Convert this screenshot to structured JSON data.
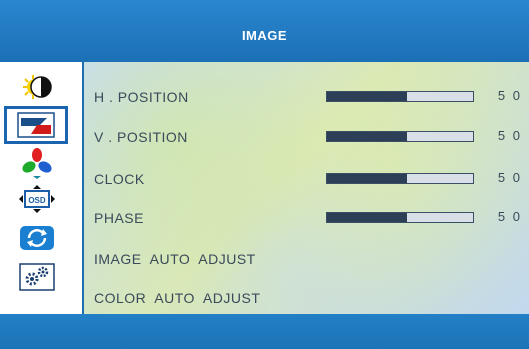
{
  "header": {
    "title": "IMAGE"
  },
  "sidebar": {
    "items": [
      {
        "icon": "brightness-contrast-icon",
        "active": false
      },
      {
        "icon": "image-icon",
        "active": true
      },
      {
        "icon": "color-icon",
        "active": false
      },
      {
        "icon": "osd-icon",
        "active": false
      },
      {
        "icon": "reset-icon",
        "active": false
      },
      {
        "icon": "settings-icon",
        "active": false
      }
    ]
  },
  "menu": {
    "items": [
      {
        "label": "H . POSITION",
        "value": "5 0",
        "level": 0.55
      },
      {
        "label": "V . POSITION",
        "value": "5 0",
        "level": 0.55
      },
      {
        "label": "CLOCK",
        "value": "5 0",
        "level": 0.55
      },
      {
        "label": "PHASE",
        "value": "5 0",
        "level": 0.55
      },
      {
        "label": "IMAGE  AUTO  ADJUST"
      },
      {
        "label": "COLOR  AUTO  ADJUST"
      }
    ]
  },
  "colors": {
    "accent": "#1c70b5",
    "bar_fill": "#2c3f56",
    "text": "#3a4a5a"
  }
}
